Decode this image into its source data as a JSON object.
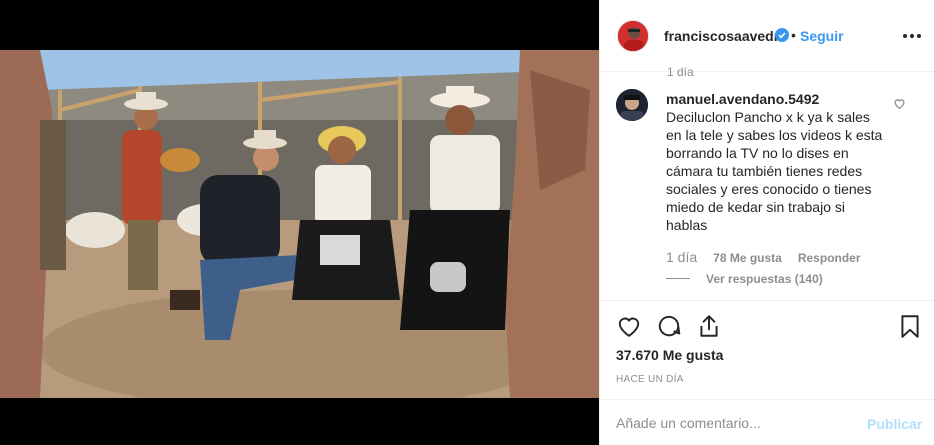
{
  "post": {
    "username": "franciscosaavedr",
    "dot": "•",
    "follow_label": "Seguir",
    "like_count": "37.670 Me gusta",
    "time_ago": "HACE UN DÍA"
  },
  "comments": {
    "previous_time": "1 día",
    "items": [
      {
        "username": "manuel.avendano.5492",
        "text": "Deciluclon Pancho x k ya k sales en la tele y sabes los videos k esta borrando la TV no lo dises en cámara tu también tienes redes sociales y eres conocido o tienes miedo de kedar sin trabajo si hablas",
        "age": "1 día",
        "likes": "78 Me gusta",
        "reply_label": "Responder",
        "view_replies": "Ver respuestas (140)"
      }
    ]
  },
  "composer": {
    "placeholder": "Añade un comentario...",
    "publish_label": "Publicar"
  },
  "icons": {
    "verified": "verified-badge-icon",
    "more": "more-options-icon",
    "comment_like": "heart-icon",
    "like": "heart-icon",
    "comment": "comment-bubble-icon",
    "share": "share-icon",
    "save": "bookmark-icon"
  },
  "colors": {
    "link_blue": "#3897f0",
    "publish_disabled": "#b2dffc",
    "muted": "#8e8e8e",
    "text": "#262626"
  }
}
